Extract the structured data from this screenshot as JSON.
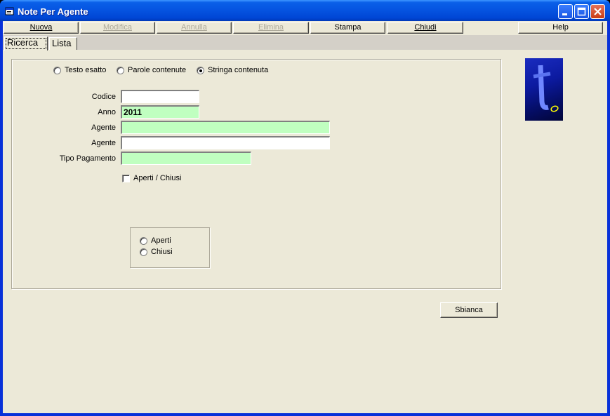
{
  "window": {
    "title": "Note Per Agente"
  },
  "toolbar": {
    "nuova": "Nuova",
    "modifica": "Modifica",
    "annulla": "Annulla",
    "elimina": "Elimina",
    "stampa": "Stampa",
    "chiudi": "Chiudi",
    "help": "Help"
  },
  "tabs": {
    "ricerca": "Ricerca",
    "lista": "Lista"
  },
  "search_mode": {
    "options": [
      "Testo esatto",
      "Parole contenute",
      "Stringa contenuta"
    ],
    "selected": "Stringa contenuta"
  },
  "form": {
    "codice": {
      "label": "Codice",
      "value": ""
    },
    "anno": {
      "label": "Anno",
      "value": "2011"
    },
    "agente1": {
      "label": "Agente",
      "value": ""
    },
    "agente2": {
      "label": "Agente",
      "value": ""
    },
    "tipo_pagamento": {
      "label": "Tipo Pagamento",
      "value": ""
    },
    "aperti_chiusi": {
      "label": "Aperti / Chiusi",
      "checked": false
    },
    "status_options": [
      "Aperti",
      "Chiusi"
    ]
  },
  "buttons": {
    "sbianca": "Sbianca"
  },
  "colors": {
    "highlight_field": "#c0ffc0",
    "logo_bg": "#0c1aa0",
    "logo_accent": "#ffff00"
  }
}
